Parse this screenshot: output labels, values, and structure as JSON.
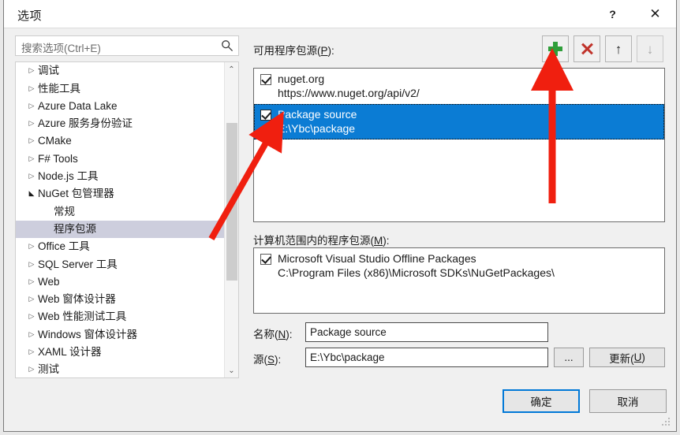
{
  "window": {
    "title": "选项",
    "help_label": "?",
    "close_label": "✕"
  },
  "search": {
    "placeholder": "搜索选项(Ctrl+E)",
    "icon": "search-icon"
  },
  "tree": {
    "items": [
      {
        "label": "调试",
        "level": 0,
        "state": "collapsed",
        "selected": false
      },
      {
        "label": "性能工具",
        "level": 0,
        "state": "collapsed",
        "selected": false
      },
      {
        "label": "Azure Data Lake",
        "level": 0,
        "state": "collapsed",
        "selected": false
      },
      {
        "label": "Azure 服务身份验证",
        "level": 0,
        "state": "collapsed",
        "selected": false
      },
      {
        "label": "CMake",
        "level": 0,
        "state": "collapsed",
        "selected": false
      },
      {
        "label": "F# Tools",
        "level": 0,
        "state": "collapsed",
        "selected": false
      },
      {
        "label": "Node.js 工具",
        "level": 0,
        "state": "collapsed",
        "selected": false
      },
      {
        "label": "NuGet 包管理器",
        "level": 0,
        "state": "expanded",
        "selected": false
      },
      {
        "label": "常规",
        "level": 1,
        "state": "leaf",
        "selected": false
      },
      {
        "label": "程序包源",
        "level": 1,
        "state": "leaf",
        "selected": true
      },
      {
        "label": "Office 工具",
        "level": 0,
        "state": "collapsed",
        "selected": false
      },
      {
        "label": "SQL Server 工具",
        "level": 0,
        "state": "collapsed",
        "selected": false
      },
      {
        "label": "Web",
        "level": 0,
        "state": "collapsed",
        "selected": false
      },
      {
        "label": "Web 窗体设计器",
        "level": 0,
        "state": "collapsed",
        "selected": false
      },
      {
        "label": "Web 性能测试工具",
        "level": 0,
        "state": "collapsed",
        "selected": false
      },
      {
        "label": "Windows 窗体设计器",
        "level": 0,
        "state": "collapsed",
        "selected": false
      },
      {
        "label": "XAML 设计器",
        "level": 0,
        "state": "collapsed",
        "selected": false
      },
      {
        "label": "测试",
        "level": 0,
        "state": "collapsed",
        "selected": false
      }
    ],
    "scroll_up_glyph": "⌃",
    "scroll_down_glyph": "⌄"
  },
  "available_sources": {
    "label_pre": "可用程序包源(",
    "label_key": "P",
    "label_post": "):",
    "toolbar": {
      "add": "add-source-button",
      "remove": "remove-source-button",
      "move_up": "move-up-button",
      "move_down": "move-down-button"
    },
    "items": [
      {
        "name": "nuget.org",
        "url": "https://www.nuget.org/api/v2/",
        "checked": true,
        "selected": false
      },
      {
        "name": "Package source",
        "url": "E:\\Ybc\\package",
        "checked": true,
        "selected": true
      }
    ]
  },
  "machine_sources": {
    "label_pre": "计算机范围内的程序包源(",
    "label_key": "M",
    "label_post": "):",
    "items": [
      {
        "name": "Microsoft Visual Studio Offline Packages",
        "url": "C:\\Program Files (x86)\\Microsoft SDKs\\NuGetPackages\\",
        "checked": true,
        "selected": false
      }
    ]
  },
  "form": {
    "name_label_pre": "名称(",
    "name_label_key": "N",
    "name_label_post": "):",
    "name_value": "Package source",
    "source_label_pre": "源(",
    "source_label_key": "S",
    "source_label_post": "):",
    "source_value": "E:\\Ybc\\package",
    "browse_label": "...",
    "update_label_pre": "更新(",
    "update_label_key": "U",
    "update_label_post": ")"
  },
  "footer": {
    "ok_label": "确定",
    "cancel_label": "取消"
  },
  "colors": {
    "selection_blue": "#0b7cd4",
    "tree_selection": "#cdcedd",
    "accent_focus": "#0078d7",
    "add_green": "#2f9e3a",
    "remove_red": "#c0332b",
    "annotation_red": "#f01f0f"
  }
}
